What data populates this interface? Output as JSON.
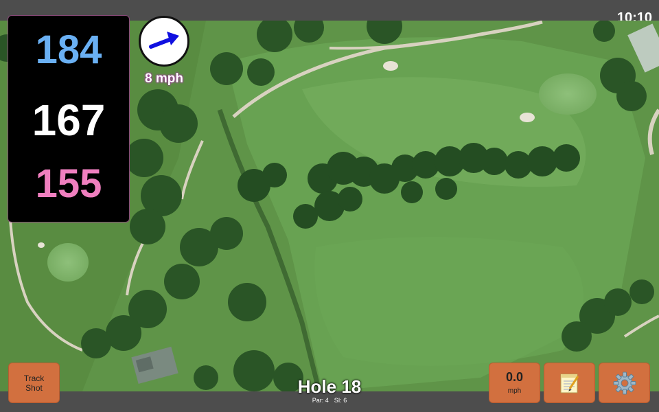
{
  "status": {
    "time": "10:10"
  },
  "yardages": {
    "back": "184",
    "middle": "167",
    "front": "155"
  },
  "wind": {
    "speed": "8 mph",
    "arrow_icon": "arrow-right-icon",
    "arrow_color": "#1010e0"
  },
  "hole": {
    "title": "Hole 18",
    "par": "Par: 4",
    "si": "SI: 6"
  },
  "buttons": {
    "track_shot": {
      "line1": "Track",
      "line2": "Shot"
    },
    "speed": {
      "value": "0.0",
      "unit": "mph"
    },
    "notes": {
      "icon": "notepad-icon"
    },
    "settings": {
      "icon": "gear-icon"
    }
  },
  "colors": {
    "back": "#6ab0f3",
    "middle": "#ffffff",
    "front": "#f07fbf",
    "button": "#d2703f"
  }
}
